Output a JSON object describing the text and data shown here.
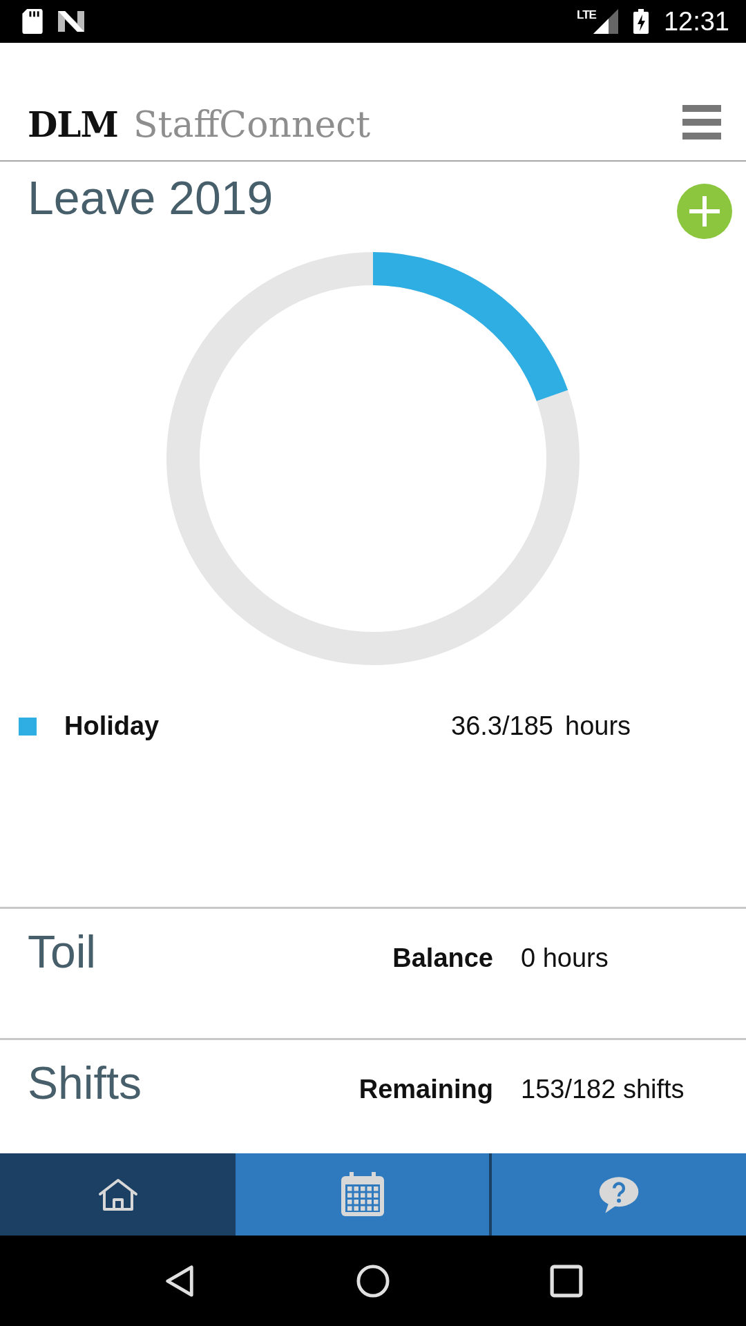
{
  "status_bar": {
    "network": "LTE",
    "time": "12:31"
  },
  "header": {
    "brand": "DLM",
    "product": "StaffConnect"
  },
  "leave": {
    "title": "Leave 2019",
    "items": [
      {
        "name": "Holiday",
        "color": "#2eaee2",
        "used": "36.3/185",
        "unit": "hours"
      }
    ]
  },
  "toil": {
    "title": "Toil",
    "label": "Balance",
    "value": "0 hours"
  },
  "shifts": {
    "title": "Shifts",
    "label": "Remaining",
    "value": "153/182 shifts"
  },
  "nav_tabs": [
    {
      "kind": "home",
      "selected": true
    },
    {
      "kind": "calendar",
      "selected": false
    },
    {
      "kind": "help",
      "selected": false
    }
  ]
}
